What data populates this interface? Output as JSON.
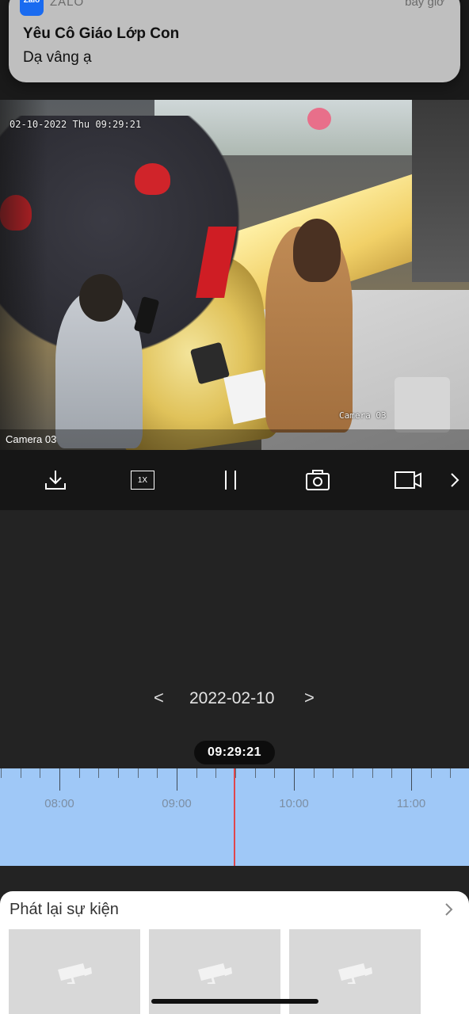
{
  "notification": {
    "app_icon_text": "Zalo",
    "app_name": "ZALO",
    "time": "bây giờ",
    "title": "Yêu Cô Giáo Lớp Con",
    "body": "Dạ vâng ạ"
  },
  "video": {
    "osd_timestamp": "02-10-2022 Thu 09:29:21",
    "osd_camera": "Camera 03",
    "camera_label": "Camera 03"
  },
  "toolbar": {
    "items": [
      {
        "name": "download-icon"
      },
      {
        "name": "speed-button",
        "label": "1X"
      },
      {
        "name": "pause-icon"
      },
      {
        "name": "snapshot-icon"
      },
      {
        "name": "record-icon"
      },
      {
        "name": "chevron-right-icon"
      }
    ]
  },
  "playback": {
    "prev_label": "<",
    "date": "2022-02-10",
    "next_label": ">",
    "current_time": "09:29:21"
  },
  "timeline": {
    "hour_labels": [
      "08:00",
      "09:00",
      "10:00",
      "11:00"
    ],
    "background_color": "#9fc8f7",
    "playhead_color": "#e0474b"
  },
  "events": {
    "title": "Phát lại sự kiện",
    "thumbnail_count": 3
  }
}
